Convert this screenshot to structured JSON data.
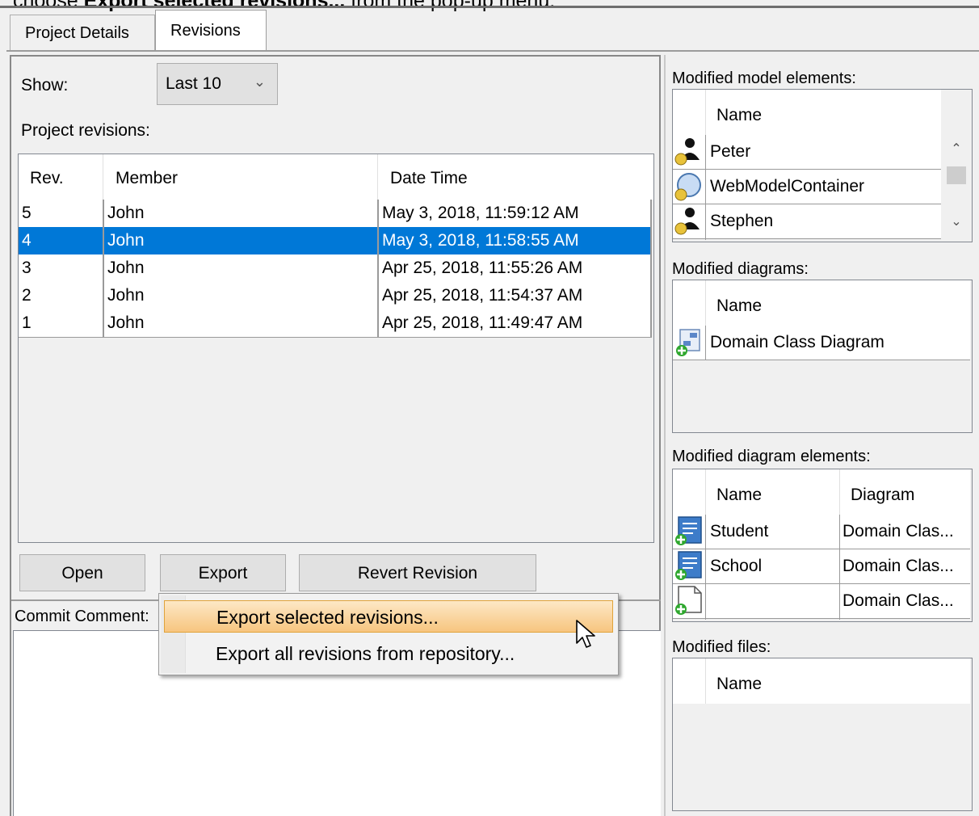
{
  "instruction": {
    "prefix": "choose ",
    "bold": "Export selected revisions...",
    "suffix": " from the pop-up menu."
  },
  "tabs": [
    {
      "label": "Project Details",
      "active": false
    },
    {
      "label": "Revisions",
      "active": true
    }
  ],
  "show": {
    "label": "Show:",
    "value": "Last 10"
  },
  "revisions": {
    "label": "Project revisions:",
    "columns": [
      "Rev.",
      "Member",
      "Date Time"
    ],
    "rows": [
      {
        "rev": "5",
        "member": "John",
        "date": "May 3, 2018, 11:59:12 AM",
        "selected": false
      },
      {
        "rev": "4",
        "member": "John",
        "date": "May 3, 2018, 11:58:55 AM",
        "selected": true
      },
      {
        "rev": "3",
        "member": "John",
        "date": "Apr 25, 2018, 11:55:26 AM",
        "selected": false
      },
      {
        "rev": "2",
        "member": "John",
        "date": "Apr 25, 2018, 11:54:37 AM",
        "selected": false
      },
      {
        "rev": "1",
        "member": "John",
        "date": "Apr 25, 2018, 11:49:47 AM",
        "selected": false
      }
    ]
  },
  "buttons": {
    "open": "Open",
    "export": "Export",
    "revert": "Revert Revision"
  },
  "commit_comment": {
    "label": "Commit Comment:"
  },
  "popup": {
    "items": [
      "Export selected revisions...",
      "Export all revisions from repository..."
    ],
    "highlighted": 0
  },
  "model_elements": {
    "label": "Modified model elements:",
    "column": "Name",
    "rows": [
      {
        "name": "Peter",
        "icon": "actor-icon"
      },
      {
        "name": "WebModelContainer",
        "icon": "container-icon"
      },
      {
        "name": "Stephen",
        "icon": "actor-icon"
      }
    ]
  },
  "diagrams": {
    "label": "Modified diagrams:",
    "column": "Name",
    "rows": [
      {
        "name": "Domain Class Diagram",
        "icon": "class-diagram-icon"
      }
    ]
  },
  "diagram_elements": {
    "label": "Modified diagram elements:",
    "columns": [
      "Name",
      "Diagram"
    ],
    "rows": [
      {
        "name": "Student",
        "diagram": "Domain Clas...",
        "icon": "class-element-icon"
      },
      {
        "name": "School",
        "diagram": "Domain Clas...",
        "icon": "class-element-icon"
      },
      {
        "name": "",
        "diagram": "Domain Clas...",
        "icon": "note-element-icon"
      }
    ]
  },
  "files": {
    "label": "Modified files:",
    "column": "Name"
  },
  "colors": {
    "selection": "#0078d7",
    "menu_highlight": "#f7c57f",
    "added_badge": "#2fa72f"
  }
}
